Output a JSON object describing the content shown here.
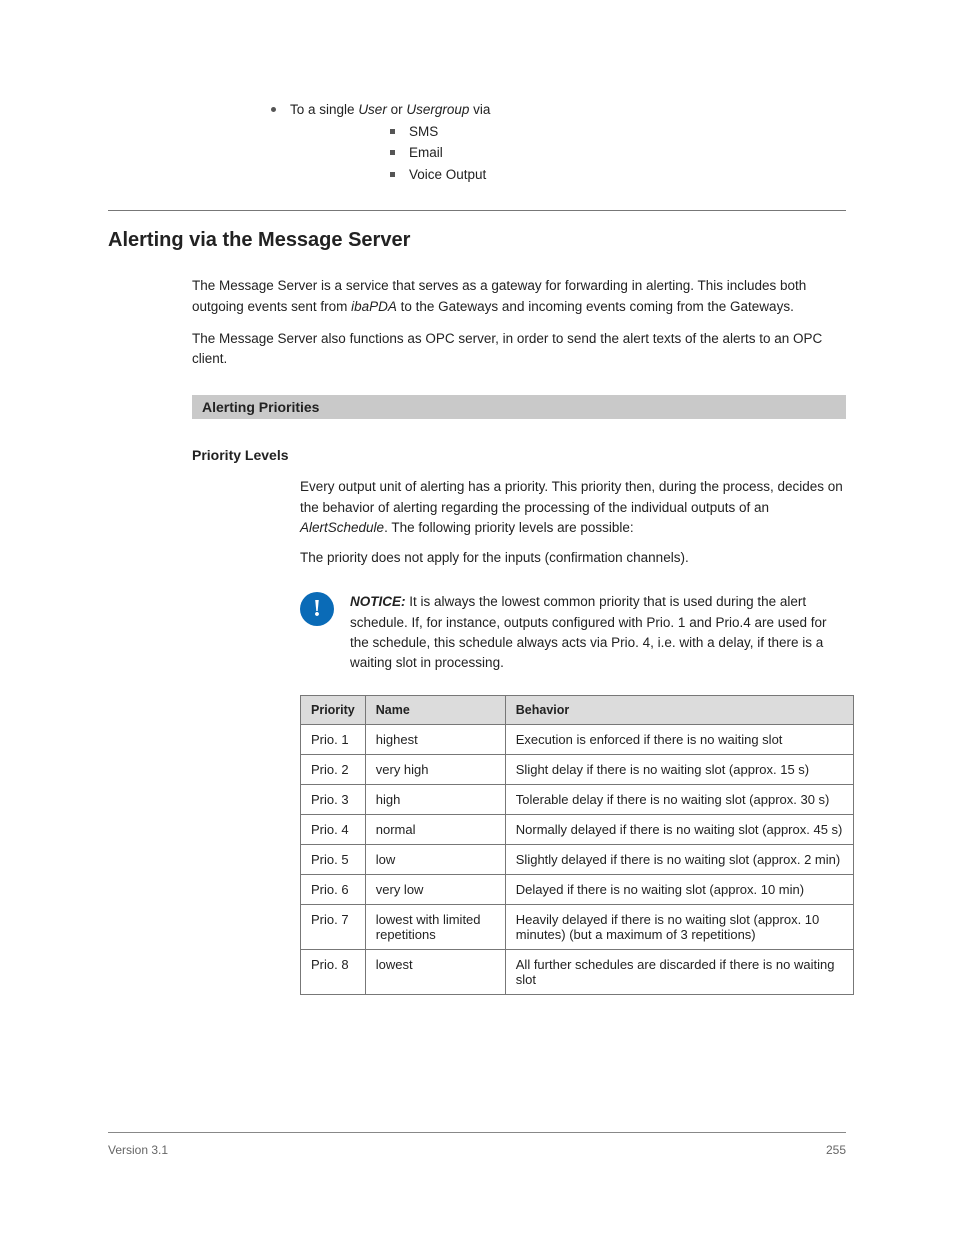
{
  "topBullet": {
    "lead": "To a single",
    "userType1": "User",
    "mid1": "or",
    "userType2": "Usergroup",
    "mid2": "via"
  },
  "subItems": [
    "SMS",
    "Email",
    "Voice Output"
  ],
  "section": {
    "h2": "Alerting via the Message Server",
    "p1_a": "The Message Server is a service that serves as a gateway for forwarding in alerting. This includes both outgoing events sent from ",
    "p1_b": " to the Gate­ways and incoming events coming from the Gateways.",
    "p2": "The Message Server also functions as OPC server, in order to send the alert texts of the alerts to an OPC client.",
    "subhead": "Alerting Priorities",
    "h3": "Priority Levels",
    "p3_a": "Every output unit of alerting has a priority. This priority then, during the pro­cess, decides on the behavior of alerting regarding the processing of the indi­vidual outputs of an ",
    "p3_b": ". The following priority levels are possible:",
    "p4": "The priority does not apply for the inputs (confirmation channels)."
  },
  "notice": {
    "label": "NOTICE:",
    "text": " It is always the lowest common priority that is used during the alert schedule. If, for instance, outputs configured with Prio. 1 and Prio.4 are used for the schedule, this schedule always acts via Prio. 4, i.e. with a delay, if there is a waiting slot in processing."
  },
  "table": {
    "headers": [
      "Priority",
      "Name",
      "Behavior"
    ],
    "rows": [
      [
        "Prio. 1",
        "highest",
        "Execution is enforced if there is no waiting slot"
      ],
      [
        "Prio. 2",
        "very high",
        "Slight delay if there is no waiting slot (approx. 15 s)"
      ],
      [
        "Prio. 3",
        "high",
        "Tolerable delay if there is no waiting slot (approx. 30 s)"
      ],
      [
        "Prio. 4",
        "normal",
        "Normally delayed if there is no waiting slot (approx. 45 s)"
      ],
      [
        "Prio. 5",
        "low",
        "Slightly delayed if there is no waiting slot (approx. 2 min)"
      ],
      [
        "Prio. 6",
        "very low",
        "Delayed if there is no waiting slot (approx. 10 min)"
      ],
      [
        "Prio. 7",
        "lowest with limited repetitions",
        "Heavily delayed if there is no waiting slot (approx. 10 minutes) (but a maximum of 3 repetitions)"
      ],
      [
        "Prio. 8",
        "lowest",
        "All further schedules are discarded if there is no waiting slot"
      ]
    ]
  },
  "footer": {
    "left": "Version 3.1",
    "right": "255"
  }
}
